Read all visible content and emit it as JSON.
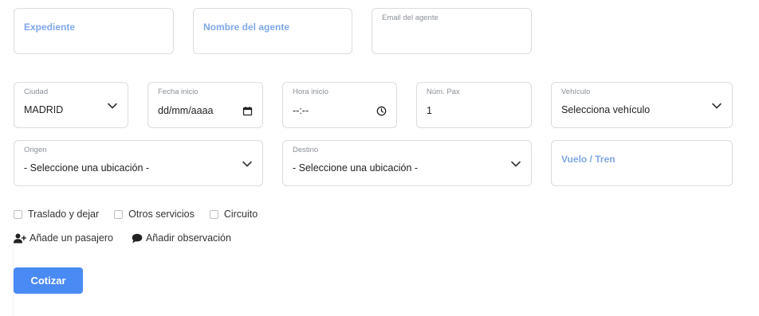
{
  "header_fields": {
    "expediente": {
      "placeholder": "Expediente"
    },
    "nombre_agente": {
      "placeholder": "Nombre del agente"
    },
    "email_agente": {
      "label": "Email del agente"
    }
  },
  "fields": {
    "ciudad": {
      "label": "Ciudad",
      "value": "MADRID",
      "icon": "chevron-down-icon"
    },
    "fecha_inicio": {
      "label": "Fecha inicio",
      "value": "dd/mm/aaaa",
      "icon": "calendar-icon"
    },
    "hora_inicio": {
      "label": "Hora inicio",
      "value": "--:--",
      "icon": "clock-icon"
    },
    "num_pax": {
      "label": "Núm. Pax",
      "value": "1"
    },
    "vehiculo": {
      "label": "Vehículo",
      "value": "Selecciona vehículo",
      "icon": "chevron-down-icon"
    },
    "origen": {
      "label": "Origen",
      "value": "- Seleccione una ubicación -",
      "icon": "chevron-down-icon"
    },
    "destino": {
      "label": "Destino",
      "value": "- Seleccione una ubicación -",
      "icon": "chevron-down-icon"
    },
    "vuelo_tren": {
      "placeholder": "Vuelo / Tren"
    }
  },
  "checkboxes": [
    {
      "label": "Traslado y dejar",
      "checked": false
    },
    {
      "label": "Otros servicios",
      "checked": false
    },
    {
      "label": "Circuito",
      "checked": false
    }
  ],
  "actions": {
    "add_passenger": {
      "label": "Añade un pasajero",
      "icon": "user-plus-icon"
    },
    "add_observation": {
      "label": "Añadir observación",
      "icon": "comment-icon"
    }
  },
  "submit": {
    "label": "Cotizar"
  },
  "colors": {
    "accent": "#4a8af4",
    "placeholder_blue": "#7fa8ea",
    "border": "#d9dce1",
    "label_gray": "#8a8f96"
  }
}
